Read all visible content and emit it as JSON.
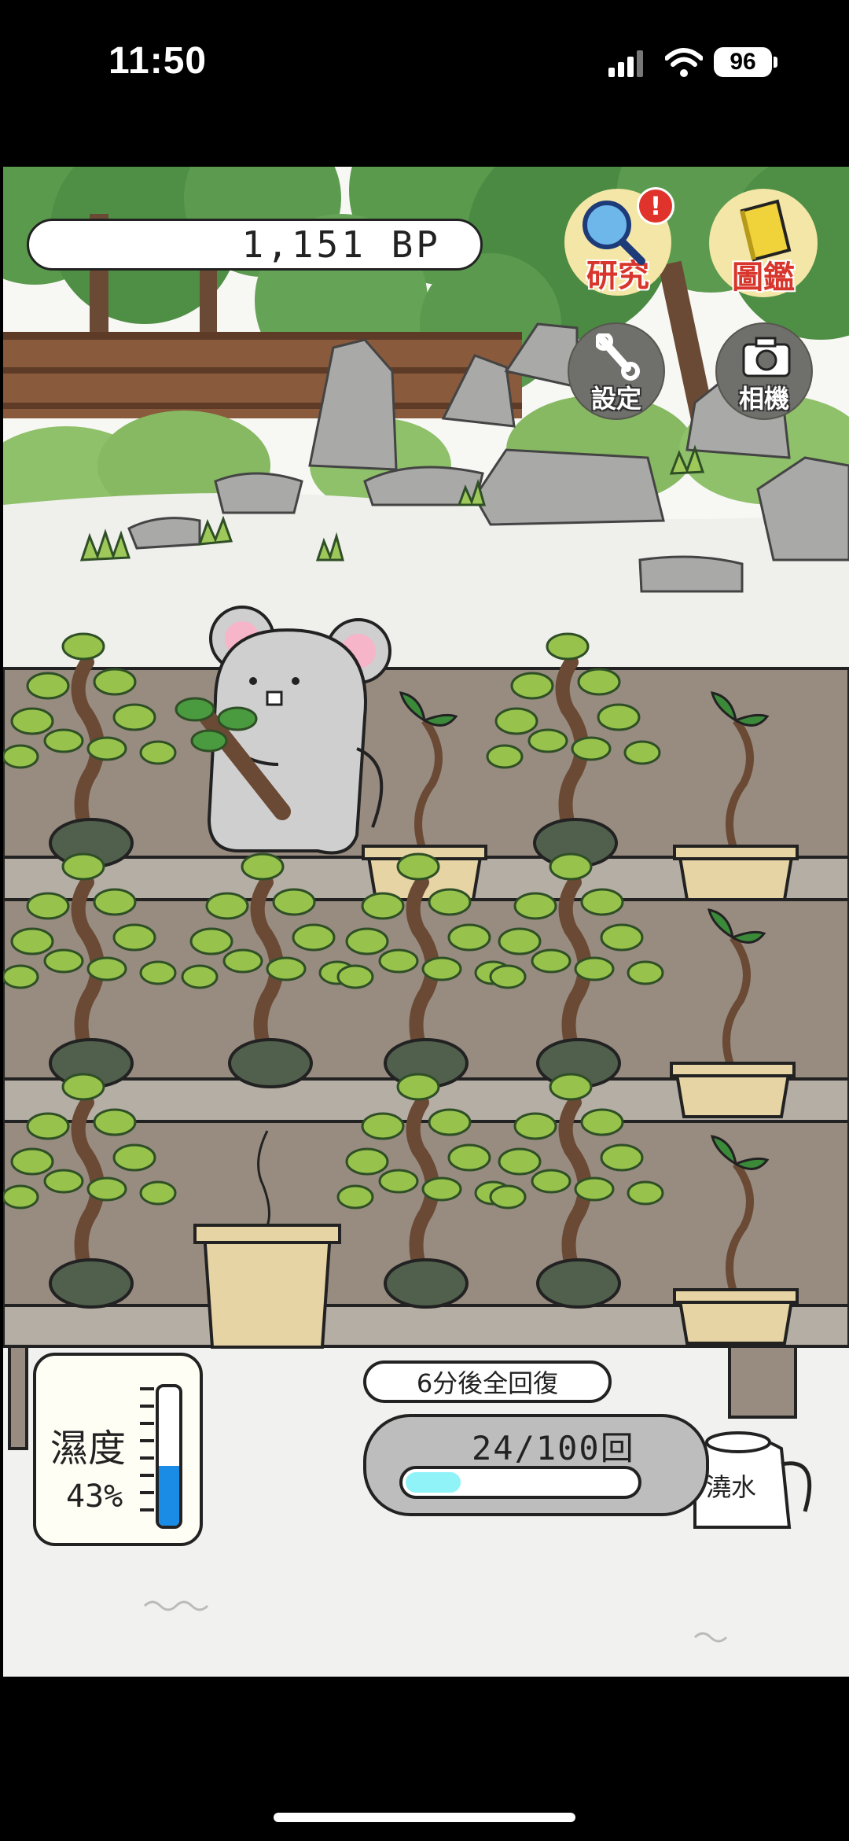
{
  "status_bar": {
    "time": "11:50",
    "battery": "96",
    "signal_icon": "cellular-signal-icon",
    "wifi_icon": "wifi-icon"
  },
  "game": {
    "bp": "1,151 BP",
    "buttons": {
      "research": "研究",
      "encyclopedia": "圖鑑",
      "settings": "設定",
      "camera": "相機"
    },
    "research_alert_icon": "exclamation-icon",
    "humidity": {
      "title": "濕度",
      "value": "43%",
      "level": 0.43
    },
    "water": {
      "recover_text": "6分後全回復",
      "count_text": "24/100回",
      "fraction": 0.24,
      "button_label": "澆水"
    },
    "shelves": [
      [
        "bonsai-pine",
        "mouse-character",
        "sprout-pot",
        "bonsai-pine",
        "sprout-pot"
      ],
      [
        "bonsai-pine",
        "bonsai-pine",
        "bonsai-pine",
        "bonsai-pine",
        "sprout-pot"
      ],
      [
        "bonsai-pine",
        "empty-pot",
        "bonsai-pine",
        "bonsai-pine",
        "sprout-pot"
      ]
    ],
    "colors": {
      "shelf": "#988c80",
      "ledge": "#b5aea5",
      "foliage": "#97c24c",
      "trunk": "#6b4a35",
      "pot_dark": "#515f4d",
      "pot_tan": "#e7d4a5",
      "research_text": "#d8362c"
    }
  }
}
